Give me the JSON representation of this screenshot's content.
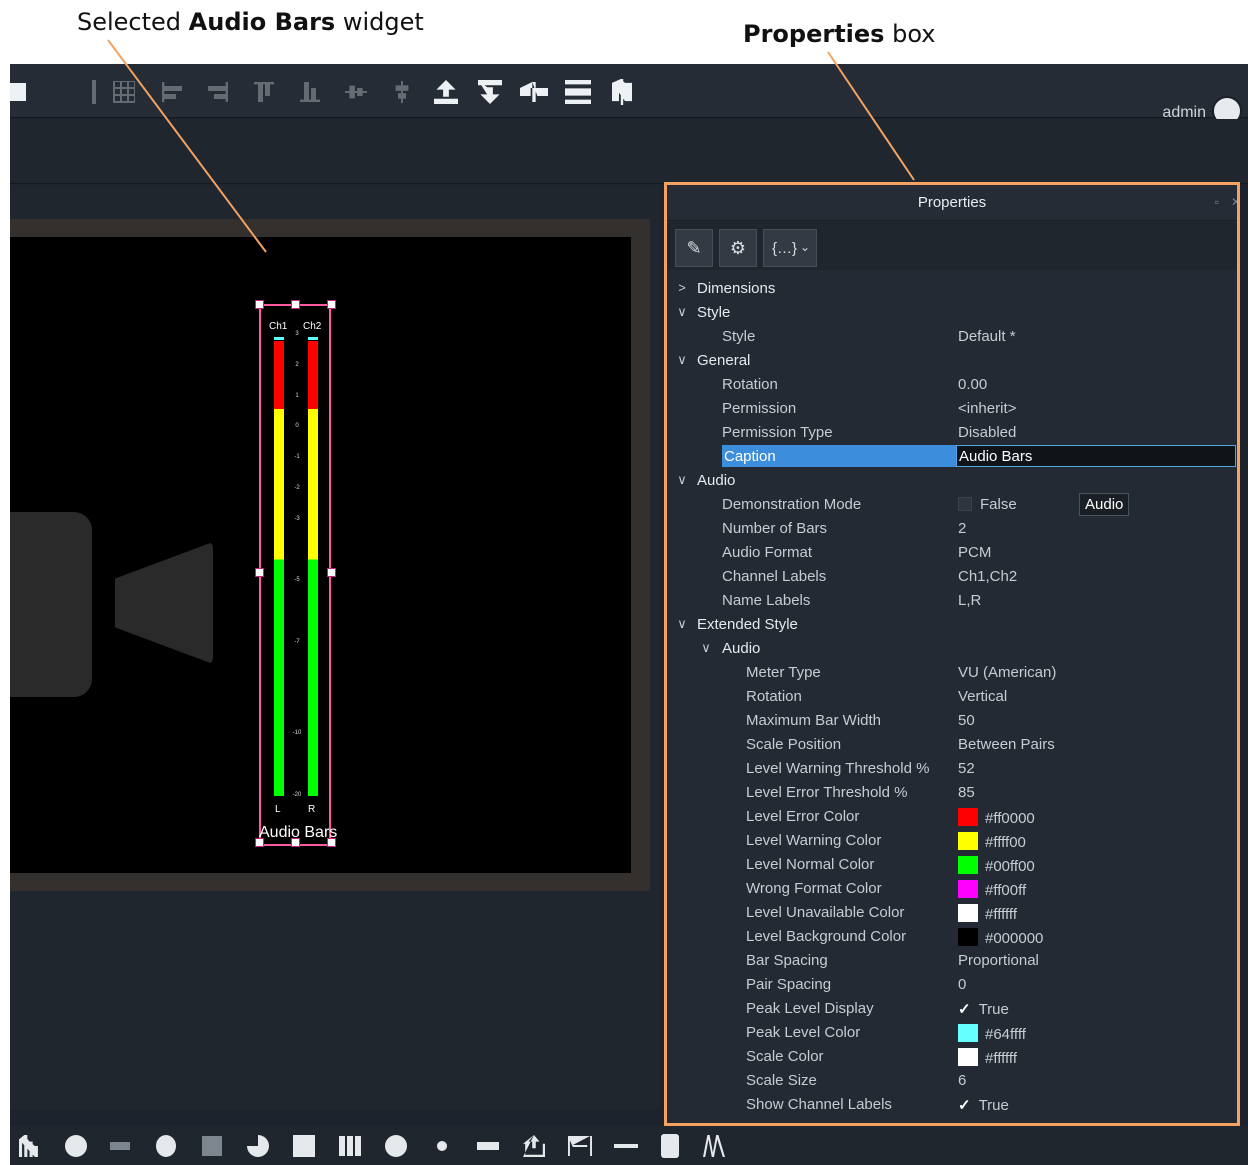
{
  "callouts": {
    "left": {
      "prefix": "Selected ",
      "bold": "Audio Bars",
      "suffix": " widget"
    },
    "right": {
      "bold": "Properties",
      "suffix": " box"
    }
  },
  "user": {
    "name": "admin"
  },
  "leader_color": "#f4a261",
  "widget": {
    "channels": [
      "Ch1",
      "Ch2"
    ],
    "name_labels": [
      "L",
      "R"
    ],
    "scale_ticks": [
      "3",
      "2",
      "1",
      "0",
      "-1",
      "-2",
      "-3",
      "-5",
      "-7",
      "-10",
      "-20"
    ],
    "caption": "Audio Bars"
  },
  "properties": {
    "title": "Properties",
    "rows": [
      {
        "type": "group",
        "level": 0,
        "label": "Dimensions",
        "expanded": false
      },
      {
        "type": "group",
        "level": 0,
        "label": "Style",
        "expanded": true
      },
      {
        "type": "prop",
        "level": 1,
        "label": "Style",
        "value": "Default *"
      },
      {
        "type": "group",
        "level": 0,
        "label": "General",
        "expanded": true
      },
      {
        "type": "prop",
        "level": 1,
        "label": "Rotation",
        "value": "0.00"
      },
      {
        "type": "prop",
        "level": 1,
        "label": "Permission",
        "value": "<inherit>"
      },
      {
        "type": "prop",
        "level": 1,
        "label": "Permission Type",
        "value": "Disabled"
      },
      {
        "type": "prop",
        "level": 1,
        "label": "Caption",
        "value": "Audio Bars",
        "selected": true
      },
      {
        "type": "group",
        "level": 0,
        "label": "Audio",
        "expanded": true
      },
      {
        "type": "prop",
        "level": 1,
        "label": "Demonstration Mode",
        "value": "False",
        "checkbox": false,
        "tooltip": "Audio"
      },
      {
        "type": "prop",
        "level": 1,
        "label": "Number of Bars",
        "value": "2"
      },
      {
        "type": "prop",
        "level": 1,
        "label": "Audio Format",
        "value": "PCM"
      },
      {
        "type": "prop",
        "level": 1,
        "label": "Channel Labels",
        "value": "Ch1,Ch2"
      },
      {
        "type": "prop",
        "level": 1,
        "label": "Name Labels",
        "value": "L,R"
      },
      {
        "type": "group",
        "level": 0,
        "label": "Extended Style",
        "expanded": true
      },
      {
        "type": "group",
        "level": 1,
        "label": "Audio",
        "expanded": true
      },
      {
        "type": "prop",
        "level": 2,
        "label": "Meter Type",
        "value": "VU (American)"
      },
      {
        "type": "prop",
        "level": 2,
        "label": "Rotation",
        "value": "Vertical"
      },
      {
        "type": "prop",
        "level": 2,
        "label": "Maximum Bar Width",
        "value": "50"
      },
      {
        "type": "prop",
        "level": 2,
        "label": "Scale Position",
        "value": "Between Pairs"
      },
      {
        "type": "prop",
        "level": 2,
        "label": "Level Warning Threshold %",
        "value": "52"
      },
      {
        "type": "prop",
        "level": 2,
        "label": "Level Error Threshold %",
        "value": "85"
      },
      {
        "type": "prop",
        "level": 2,
        "label": "Level Error Color",
        "value": "#ff0000",
        "swatch": "#ff0000"
      },
      {
        "type": "prop",
        "level": 2,
        "label": "Level Warning Color",
        "value": "#ffff00",
        "swatch": "#ffff00"
      },
      {
        "type": "prop",
        "level": 2,
        "label": "Level Normal Color",
        "value": "#00ff00",
        "swatch": "#00ff00"
      },
      {
        "type": "prop",
        "level": 2,
        "label": "Wrong Format Color",
        "value": "#ff00ff",
        "swatch": "#ff00ff"
      },
      {
        "type": "prop",
        "level": 2,
        "label": "Level Unavailable Color",
        "value": "#ffffff",
        "swatch": "#ffffff"
      },
      {
        "type": "prop",
        "level": 2,
        "label": "Level Background Color",
        "value": "#000000",
        "swatch": "#000000"
      },
      {
        "type": "prop",
        "level": 2,
        "label": "Bar Spacing",
        "value": "Proportional"
      },
      {
        "type": "prop",
        "level": 2,
        "label": "Pair Spacing",
        "value": "0"
      },
      {
        "type": "prop",
        "level": 2,
        "label": "Peak Level Display",
        "value": "True",
        "checkbox": true
      },
      {
        "type": "prop",
        "level": 2,
        "label": "Peak Level Color",
        "value": "#64ffff",
        "swatch": "#64ffff"
      },
      {
        "type": "prop",
        "level": 2,
        "label": "Scale Color",
        "value": "#ffffff",
        "swatch": "#ffffff"
      },
      {
        "type": "prop",
        "level": 2,
        "label": "Scale Size",
        "value": "6"
      },
      {
        "type": "prop",
        "level": 2,
        "label": "Show Channel Labels",
        "value": "True",
        "checkbox": true
      }
    ]
  }
}
